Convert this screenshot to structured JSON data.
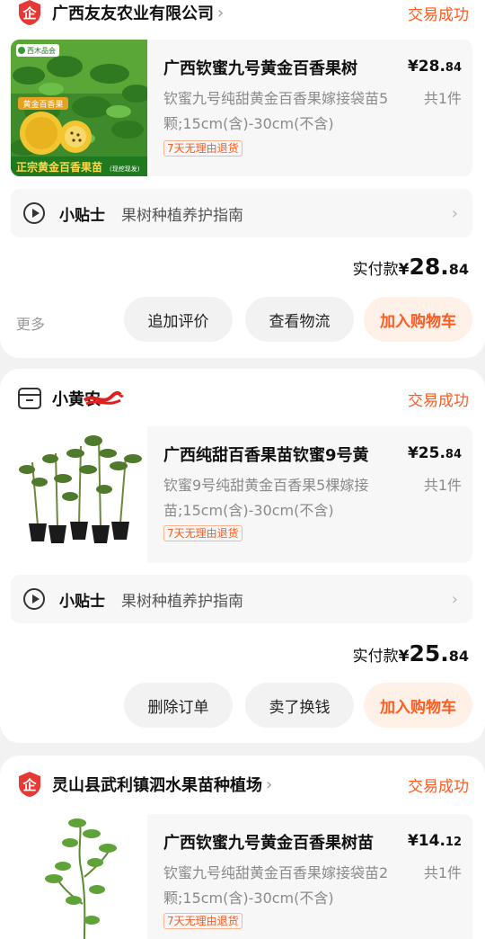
{
  "colors": {
    "accent": "#ff5a1f",
    "badge_red": "#e53935"
  },
  "orders": [
    {
      "shop": {
        "name": "广西友友农业有限公司",
        "icon": "enterprise-badge-icon"
      },
      "status": "交易成功",
      "product": {
        "title": "广西钦蜜九号黄金百香果树",
        "price_currency": "¥",
        "price_int": "28.",
        "price_cents": "84",
        "desc": "钦蜜九号纯甜黄金百香果嫁接袋苗5颗;15cm(含)-30cm(不含)",
        "qty": "共1件",
        "tag": "7天无理由退货",
        "image_texts": {
          "brand": "西木品会",
          "fruit": "黄金百香果",
          "caption": "正宗黄金百香果苗",
          "caption_small": "(现挖现发)"
        }
      },
      "tip": {
        "title": "小贴士",
        "text": "果树种植养护指南"
      },
      "paid": {
        "label": "实付款",
        "currency": "¥",
        "int": "28.",
        "cents": "84"
      },
      "more": "更多",
      "buttons": [
        "追加评价",
        "查看物流",
        "加入购物车"
      ]
    },
    {
      "shop": {
        "name": "小黄农",
        "icon": "store-icon"
      },
      "status": "交易成功",
      "product": {
        "title": "广西纯甜百香果苗钦蜜9号黄",
        "price_currency": "¥",
        "price_int": "25.",
        "price_cents": "84",
        "desc": "钦蜜9号纯甜黄金百香果5棵嫁接苗;15cm(含)-30cm(不含)",
        "qty": "共1件",
        "tag": "7天无理由退货"
      },
      "tip": {
        "title": "小贴士",
        "text": "果树种植养护指南"
      },
      "paid": {
        "label": "实付款",
        "currency": "¥",
        "int": "25.",
        "cents": "84"
      },
      "buttons": [
        "删除订单",
        "卖了换钱",
        "加入购物车"
      ]
    },
    {
      "shop": {
        "name": "灵山县武利镇泗水果苗种植场",
        "icon": "enterprise-badge-icon"
      },
      "status": "交易成功",
      "product": {
        "title": "广西钦蜜九号黄金百香果树苗",
        "price_currency": "¥",
        "price_int": "14.",
        "price_cents": "12",
        "desc": "钦蜜九号纯甜黄金百香果嫁接袋苗2颗;15cm(含)-30cm(不含)",
        "qty": "共1件",
        "tag": "7天无理由退货"
      }
    }
  ]
}
